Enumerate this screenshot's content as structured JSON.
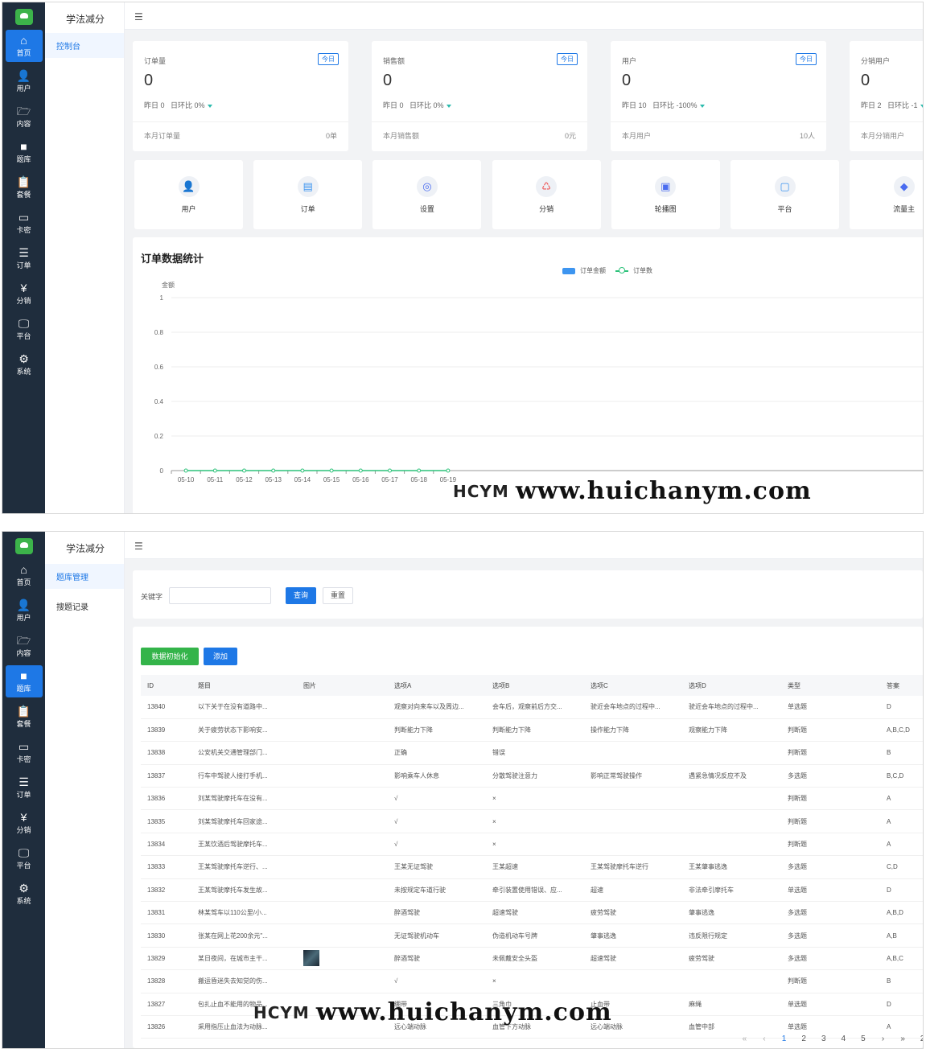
{
  "app": {
    "name": "学法减分"
  },
  "nav": [
    {
      "id": "home",
      "icon": "house-icon",
      "glyph": "⌂",
      "label": "首页"
    },
    {
      "id": "user",
      "icon": "user-icon",
      "glyph": "👤",
      "label": "用户"
    },
    {
      "id": "content",
      "icon": "folder-open-icon",
      "glyph": "🗁",
      "label": "内容"
    },
    {
      "id": "bank",
      "icon": "folder-icon",
      "glyph": "■",
      "label": "题库"
    },
    {
      "id": "package",
      "icon": "clipboard-icon",
      "glyph": "📋",
      "label": "套餐"
    },
    {
      "id": "card",
      "icon": "card-icon",
      "glyph": "▭",
      "label": "卡密"
    },
    {
      "id": "order",
      "icon": "list-icon",
      "glyph": "☰",
      "label": "订单"
    },
    {
      "id": "dist",
      "icon": "coin-icon",
      "glyph": "¥",
      "label": "分销"
    },
    {
      "id": "platform",
      "icon": "monitor-icon",
      "glyph": "🖵",
      "label": "平台"
    },
    {
      "id": "system",
      "icon": "gear-icon",
      "glyph": "⚙",
      "label": "系统"
    }
  ],
  "dashboard": {
    "submenu": {
      "item": "控制台"
    },
    "stats": [
      {
        "title": "订单量",
        "badge": "今日",
        "value": "0",
        "compare": "昨日 0   日环比 0%",
        "month_label": "本月订单量",
        "month_value": "0单"
      },
      {
        "title": "销售额",
        "badge": "今日",
        "value": "0",
        "compare": "昨日 0   日环比 0%",
        "month_label": "本月销售额",
        "month_value": "0元"
      },
      {
        "title": "用户",
        "badge": "今日",
        "value": "0",
        "compare": "昨日 10   日环比 -100%",
        "month_label": "本月用户",
        "month_value": "10人"
      },
      {
        "title": "分销用户",
        "badge": "今日",
        "value": "0",
        "compare": "昨日 2   日环比 -1",
        "month_label": "本月分销用户",
        "month_value": ""
      }
    ],
    "quick": [
      {
        "label": "用户",
        "icon": "user-avatar-icon",
        "glyph": "👤",
        "color": "#e8673c"
      },
      {
        "label": "订单",
        "icon": "order-icon",
        "glyph": "▤",
        "color": "#3d95f0"
      },
      {
        "label": "设置",
        "icon": "settings-icon",
        "glyph": "◎",
        "color": "#4a6cf0"
      },
      {
        "label": "分销",
        "icon": "share-icon",
        "glyph": "♺",
        "color": "#ee4d4d"
      },
      {
        "label": "轮播图",
        "icon": "carousel-icon",
        "glyph": "▣",
        "color": "#4a6cf0"
      },
      {
        "label": "平台",
        "icon": "platform-icon",
        "glyph": "▢",
        "color": "#3d95f0"
      },
      {
        "label": "流量主",
        "icon": "diamond-icon",
        "glyph": "◆",
        "color": "#4a6cf0"
      }
    ]
  },
  "chart_data": {
    "type": "bar",
    "title": "订单数据统计",
    "ylabel": "金额",
    "ylim": [
      0,
      1
    ],
    "y_ticks": [
      "1",
      "0.8",
      "0.6",
      "0.4",
      "0.2",
      "0"
    ],
    "categories": [
      "05-10",
      "05-11",
      "05-12",
      "05-13",
      "05-14",
      "05-15",
      "05-16",
      "05-17",
      "05-18",
      "05-19"
    ],
    "series": [
      {
        "name": "订单金额",
        "type": "bar",
        "color": "#3d95f0",
        "values": [
          0,
          0,
          0,
          0,
          0,
          0,
          0,
          0,
          0,
          0
        ]
      },
      {
        "name": "订单数",
        "type": "line",
        "color": "#2dc27a",
        "values": [
          0,
          0,
          0,
          0,
          0,
          0,
          0,
          0,
          0,
          0
        ]
      }
    ],
    "grid": true,
    "legend_position": "top-center"
  },
  "watermark": {
    "logo": "HCYM",
    "url": "www.huichanym.com"
  },
  "bank": {
    "submenu": [
      "题库管理",
      "搜题记录"
    ],
    "filter": {
      "label": "关键字",
      "placeholder": "",
      "search": "查询",
      "reset": "重置"
    },
    "actions": {
      "init": "数据初始化",
      "add": "添加"
    },
    "columns": [
      "ID",
      "题目",
      "图片",
      "选项A",
      "选项B",
      "选项C",
      "选项D",
      "类型",
      "答案"
    ],
    "rows": [
      [
        "13840",
        "以下关于在没有道路中...",
        "",
        "观察对向来车以及周边...",
        "会车后，观察前后方交...",
        "驶近会车地点的过程中...",
        "驶近会车地点的过程中...",
        "单选题",
        "D"
      ],
      [
        "13839",
        "关于疲劳状态下影响安...",
        "",
        "判断能力下降",
        "判断能力下降",
        "操作能力下降",
        "观察能力下降",
        "判断题",
        "A,B,C,D"
      ],
      [
        "13838",
        "公安机关交通管理部门...",
        "",
        "正确",
        "错误",
        "",
        "",
        "判断题",
        "B"
      ],
      [
        "13837",
        "行车中驾驶人接打手机...",
        "",
        "影响乘车人休息",
        "分散驾驶注意力",
        "影响正常驾驶操作",
        "遇紧急情况反应不及",
        "多选题",
        "B,C,D"
      ],
      [
        "13836",
        "刘某驾驶摩托车在没有...",
        "",
        "√",
        "×",
        "",
        "",
        "判断题",
        "A"
      ],
      [
        "13835",
        "刘某驾驶摩托车回家途...",
        "",
        "√",
        "×",
        "",
        "",
        "判断题",
        "A"
      ],
      [
        "13834",
        "王某饮酒后驾驶摩托车...",
        "",
        "√",
        "×",
        "",
        "",
        "判断题",
        "A"
      ],
      [
        "13833",
        "王某驾驶摩托车逆行、...",
        "",
        "王某无证驾驶",
        "王某超速",
        "王某驾驶摩托车逆行",
        "王某肇事逃逸",
        "多选题",
        "C,D"
      ],
      [
        "13832",
        "王某驾驶摩托车发生故...",
        "",
        "未按规定车道行驶",
        "牵引装置使用错误、应...",
        "超速",
        "非法牵引摩托车",
        "单选题",
        "D"
      ],
      [
        "13831",
        "林某驾车以110公里/小...",
        "",
        "醉酒驾驶",
        "超速驾驶",
        "疲劳驾驶",
        "肇事逃逸",
        "多选题",
        "A,B,D"
      ],
      [
        "13830",
        "张某在网上花200余元\"...",
        "",
        "无证驾驶机动车",
        "伪造机动车号牌",
        "肇事逃逸",
        "违反限行规定",
        "多选题",
        "A,B"
      ],
      [
        "13829",
        "某日夜间，在城市主干...",
        "img",
        "醉酒驾驶",
        "未佩戴安全头盔",
        "超速驾驶",
        "疲劳驾驶",
        "多选题",
        "A,B,C"
      ],
      [
        "13828",
        "搬运昏迷失去知觉的伤...",
        "",
        "√",
        "×",
        "",
        "",
        "判断题",
        "B"
      ],
      [
        "13827",
        "包扎止血不能用的物品...",
        "",
        "绷带",
        "三角巾",
        "止血带",
        "麻绳",
        "单选题",
        "D"
      ],
      [
        "13826",
        "采用指压止血法为动脉...",
        "",
        "远心端动脉",
        "血管下方动脉",
        "远心端动脉",
        "血管中部",
        "单选题",
        "A"
      ]
    ],
    "pagination": [
      "«",
      "‹",
      "1",
      "2",
      "3",
      "4",
      "5",
      "›",
      "»",
      "2"
    ]
  }
}
